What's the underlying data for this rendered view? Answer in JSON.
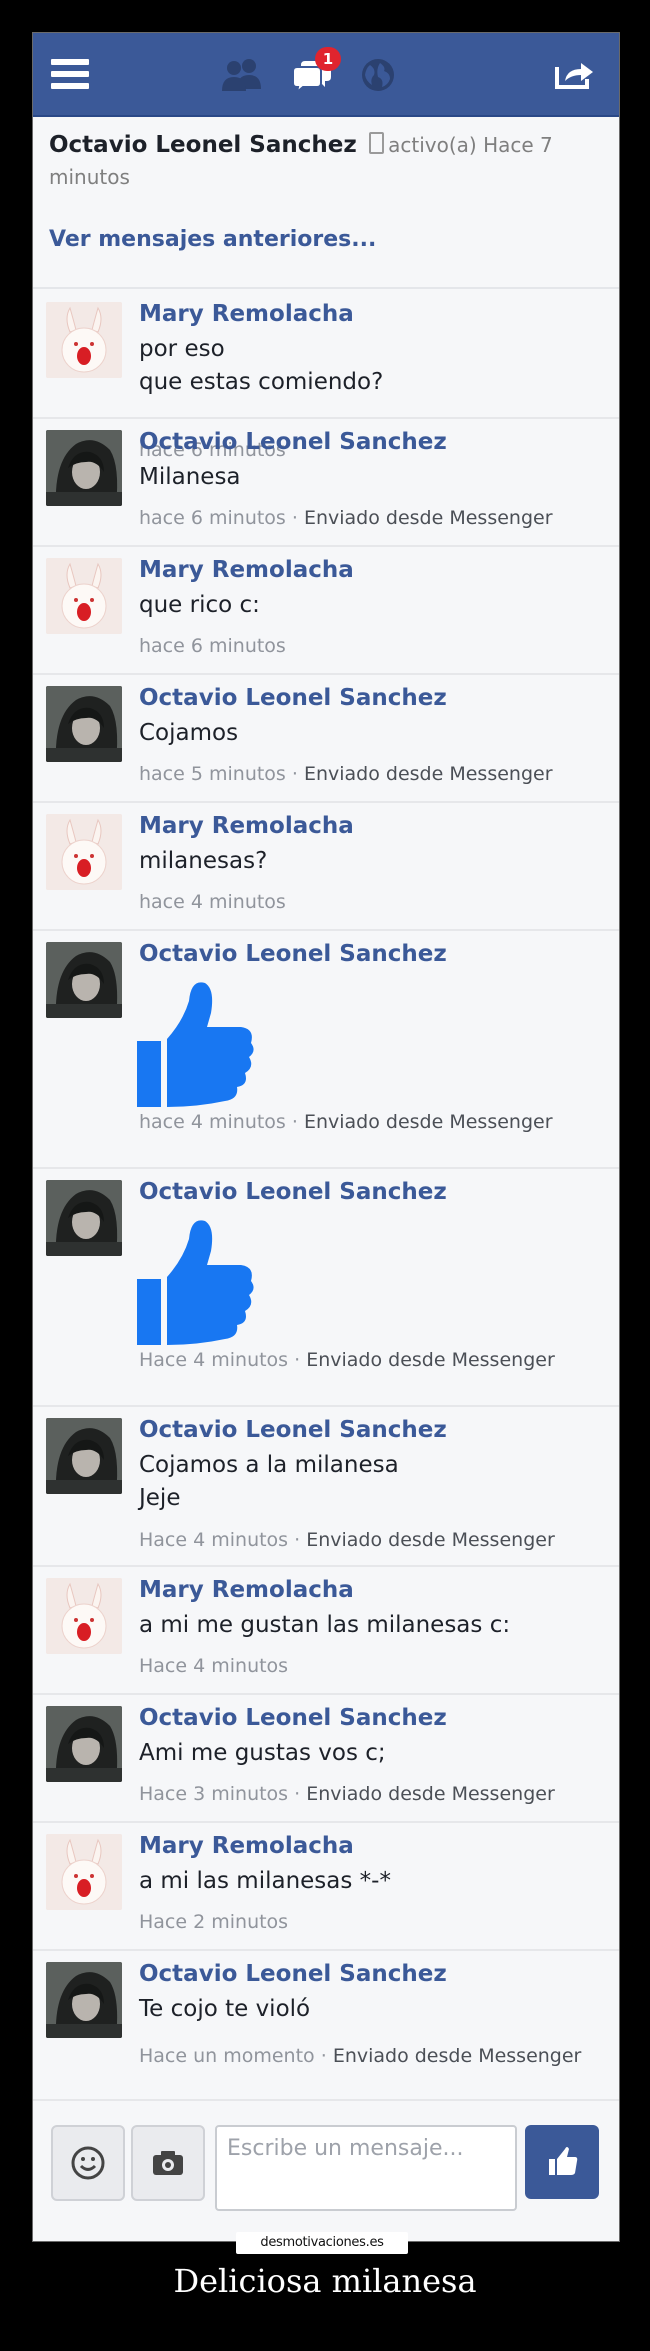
{
  "topbar": {
    "notification_count": "1"
  },
  "header": {
    "contact_name": "Octavio Leonel Sanchez",
    "status": "activo(a) Hace 7 minutos",
    "older_link": "Ver mensajes anteriores..."
  },
  "messages": [
    {
      "sender": "Mary Remolacha",
      "text": "por eso\nque estas comiendo?",
      "time": "hace 6 minutos",
      "via": ""
    },
    {
      "sender": "Octavio Leonel Sanchez",
      "text": "Milanesa",
      "time": "hace 6 minutos",
      "via": "Enviado desde Messenger"
    },
    {
      "sender": "Mary Remolacha",
      "text": "que rico c:",
      "time": "hace 6 minutos",
      "via": ""
    },
    {
      "sender": "Octavio Leonel Sanchez",
      "text": "Cojamos",
      "time": "hace 5 minutos",
      "via": "Enviado desde Messenger"
    },
    {
      "sender": "Mary Remolacha",
      "text": "milanesas?",
      "time": "hace 4 minutos",
      "via": ""
    },
    {
      "sender": "Octavio Leonel Sanchez",
      "text": "",
      "sticker": "thumbs-up",
      "time": "hace 4 minutos",
      "via": "Enviado desde Messenger"
    },
    {
      "sender": "Octavio Leonel Sanchez",
      "text": "",
      "sticker": "thumbs-up",
      "time": "Hace 4 minutos",
      "via": "Enviado desde Messenger"
    },
    {
      "sender": "Octavio Leonel Sanchez",
      "text": "Cojamos a la milanesa\nJeje",
      "time": "Hace 4 minutos",
      "via": "Enviado desde Messenger"
    },
    {
      "sender": "Mary Remolacha",
      "text": "a mi me gustan las milanesas c:",
      "time": "Hace 4 minutos",
      "via": ""
    },
    {
      "sender": "Octavio Leonel Sanchez",
      "text": "Ami me gustas vos c;",
      "time": "Hace 3 minutos",
      "via": "Enviado desde Messenger"
    },
    {
      "sender": "Mary Remolacha",
      "text": "a mi las milanesas *-*",
      "time": "Hace 2 minutos",
      "via": ""
    },
    {
      "sender": "Octavio Leonel Sanchez",
      "text": "Te cojo te violó",
      "time": "Hace un momento",
      "via": "Enviado desde Messenger"
    }
  ],
  "composer": {
    "placeholder": "Escribe un mensaje..."
  },
  "footer": {
    "watermark": "desmotivaciones.es",
    "caption": "Deliciosa milanesa"
  },
  "colors": {
    "facebook_blue": "#3b5998",
    "like_blue": "#1877f2",
    "badge_red": "#e0242e"
  },
  "icons": [
    "menu-icon",
    "friends-icon",
    "messages-icon",
    "globe-icon",
    "share-icon",
    "thumbs-up-icon",
    "emoji-icon",
    "camera-icon",
    "like-send-icon"
  ]
}
